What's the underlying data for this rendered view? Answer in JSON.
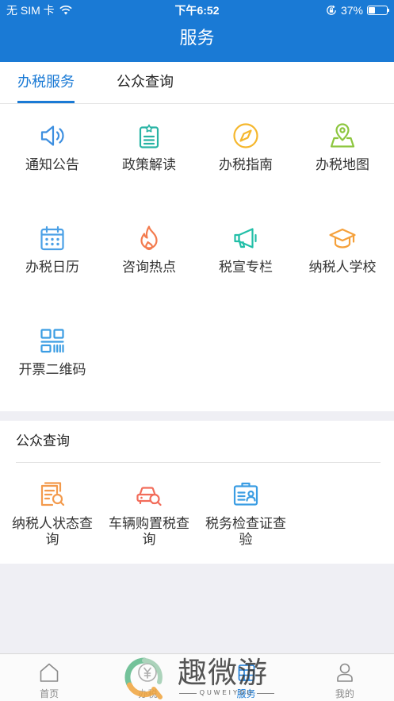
{
  "theme": {
    "primary": "#1a7ad5"
  },
  "status_bar": {
    "carrier": "无 SIM 卡",
    "time": "下午6:52",
    "battery": "37%",
    "battery_level": 0.37
  },
  "header": {
    "title": "服务"
  },
  "tabs": [
    {
      "label": "办税服务",
      "active": true
    },
    {
      "label": "公众查询",
      "active": false
    }
  ],
  "services": [
    {
      "label": "通知公告",
      "icon": "speaker-icon",
      "color": "#3d8fe0"
    },
    {
      "label": "政策解读",
      "icon": "clipboard-star-icon",
      "color": "#27b3a4"
    },
    {
      "label": "办税指南",
      "icon": "compass-icon",
      "color": "#f5b72d"
    },
    {
      "label": "办税地图",
      "icon": "map-pin-icon",
      "color": "#8dc63f"
    },
    {
      "label": "办税日历",
      "icon": "calendar-icon",
      "color": "#4aa0e6"
    },
    {
      "label": "咨询热点",
      "icon": "flame-icon",
      "color": "#f37b4e"
    },
    {
      "label": "税宣专栏",
      "icon": "megaphone-icon",
      "color": "#22bfa8"
    },
    {
      "label": "纳税人学校",
      "icon": "graduation-cap-icon",
      "color": "#f5a03a"
    },
    {
      "label": "开票二维码",
      "icon": "qr-code-icon",
      "color": "#3b9de3"
    }
  ],
  "public_query": {
    "heading": "公众查询",
    "items": [
      {
        "label": "纳税人状态查询",
        "icon": "document-search-icon",
        "color": "#f39a4c"
      },
      {
        "label": "车辆购置税查询",
        "icon": "car-search-icon",
        "color": "#f26c5a"
      },
      {
        "label": "税务检查证查验",
        "icon": "id-card-icon",
        "color": "#3b9de3"
      }
    ]
  },
  "tabbar": {
    "items": [
      {
        "label": "首页",
        "icon": "home-icon",
        "active": false
      },
      {
        "label": "办税",
        "icon": "tax-icon",
        "active": false
      },
      {
        "label": "服务",
        "icon": "service-icon",
        "active": true
      },
      {
        "label": "我的",
        "icon": "profile-icon",
        "active": false
      }
    ]
  },
  "watermark": {
    "brand": "趣微游",
    "latin": "QUWEIYOU"
  }
}
